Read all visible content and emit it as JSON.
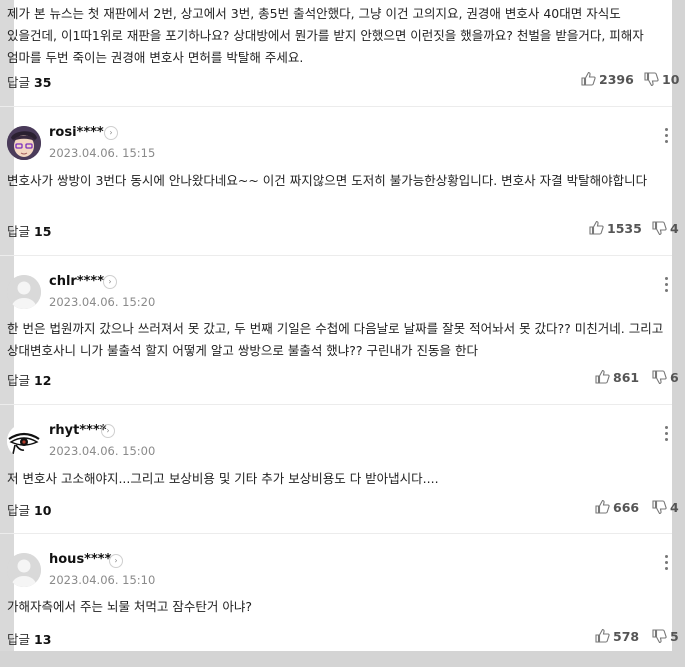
{
  "top_comment": {
    "text": "제가 본 뉴스는 첫 재판에서 2번, 상고에서 3번, 총5번 출석안했다, 그냥 이건 고의지요, 권경애 변호사 40대면 자식도 있을건데, 이1따1위로 재판을 포기하나요? 상대방에서 뭔가를 받지 안했으면 이런짓을 했을까요? 천벌을 받을거다, 피해자 엄마를 두번 죽이는 권경애 변호사 면허를 박탈해 주세요.",
    "reply_label": "답글",
    "reply_count": "35",
    "likes": "2396",
    "dislikes": "10"
  },
  "comments": [
    {
      "user": "rosi****",
      "date": "2023.04.06. 15:15",
      "text": "변호사가 쌍방이 3번다 동시에 안나왔다네요~~ 이건 짜지않으면 도저히 불가능한상황입니다. 변호사 자결 박탈해야합니다",
      "reply_label": "답글",
      "reply_count": "15",
      "likes": "1535",
      "dislikes": "4"
    },
    {
      "user": "chlr****",
      "date": "2023.04.06. 15:20",
      "text": "한 번은 법원까지 갔으나 쓰러져서 못 갔고, 두 번째 기일은 수첩에 다음날로 날짜를 잘못 적어놔서 못 갔다?? 미친거네. 그리고 상대변호사니 니가 불출석 할지 어떻게 알고 쌍방으로 불출석 했냐?? 구린내가 진동을 한다",
      "reply_label": "답글",
      "reply_count": "12",
      "likes": "861",
      "dislikes": "6"
    },
    {
      "user": "rhyt****",
      "date": "2023.04.06. 15:00",
      "text": "저 변호사 고소해야지...그리고 보상비용 및 기타 추가 보상비용도 다 받아냅시다....",
      "reply_label": "답글",
      "reply_count": "10",
      "likes": "666",
      "dislikes": "4"
    },
    {
      "user": "hous****",
      "date": "2023.04.06. 15:10",
      "text": "가해자측에서 주는 뇌물 처먹고 잠수탄거 아냐?",
      "reply_label": "답글",
      "reply_count": "13",
      "likes": "578",
      "dislikes": "5"
    }
  ],
  "icons": {
    "profile_chevron": "chevron-right-icon",
    "like": "thumbs-up-icon",
    "dislike": "thumbs-down-icon",
    "more": "more-vertical-icon"
  }
}
